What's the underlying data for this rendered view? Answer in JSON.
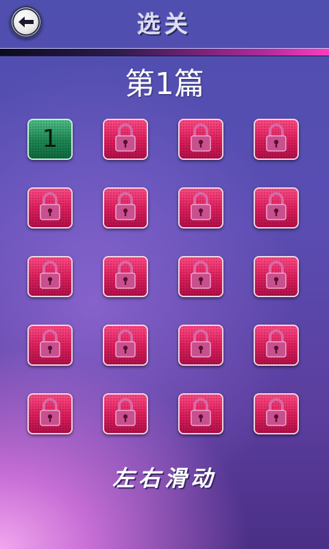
{
  "header": {
    "back_icon": "back-arrow-icon",
    "title": "选关"
  },
  "chapter_label": "第1篇",
  "levels": [
    {
      "label": "1",
      "state": "unlocked"
    },
    {
      "label": "",
      "state": "locked"
    },
    {
      "label": "",
      "state": "locked"
    },
    {
      "label": "",
      "state": "locked"
    },
    {
      "label": "",
      "state": "locked"
    },
    {
      "label": "",
      "state": "locked"
    },
    {
      "label": "",
      "state": "locked"
    },
    {
      "label": "",
      "state": "locked"
    },
    {
      "label": "",
      "state": "locked"
    },
    {
      "label": "",
      "state": "locked"
    },
    {
      "label": "",
      "state": "locked"
    },
    {
      "label": "",
      "state": "locked"
    },
    {
      "label": "",
      "state": "locked"
    },
    {
      "label": "",
      "state": "locked"
    },
    {
      "label": "",
      "state": "locked"
    },
    {
      "label": "",
      "state": "locked"
    },
    {
      "label": "",
      "state": "locked"
    },
    {
      "label": "",
      "state": "locked"
    },
    {
      "label": "",
      "state": "locked"
    },
    {
      "label": "",
      "state": "locked"
    }
  ],
  "lock_icon": "padlock-icon",
  "footer_hint": "左右滑动",
  "colors": {
    "locked_tile": "#e0205e",
    "unlocked_tile": "#1f8a56"
  }
}
